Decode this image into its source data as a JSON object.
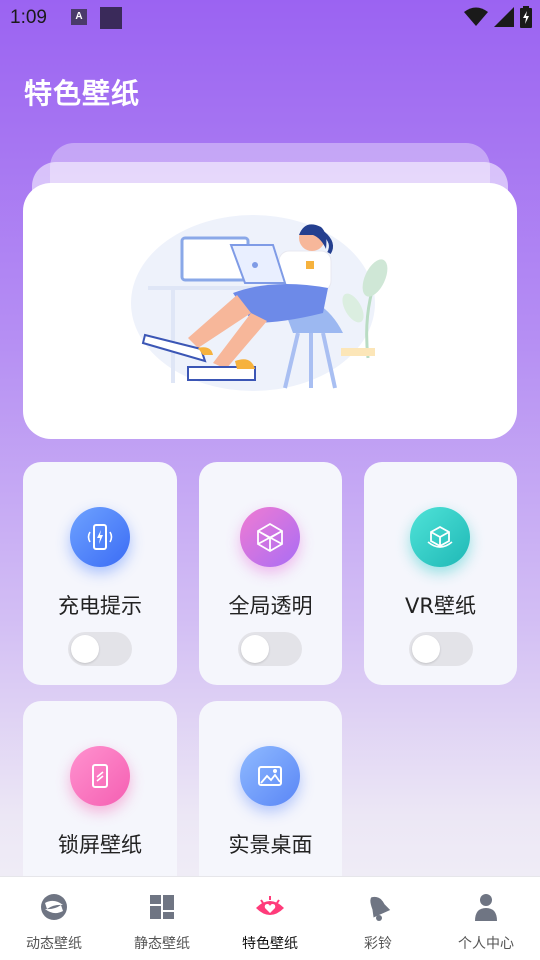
{
  "status_bar": {
    "time": "1:09",
    "a_icon_letter": "A"
  },
  "header": {
    "title": "特色壁纸"
  },
  "features": [
    {
      "label": "充电提示",
      "icon": "charging-phone-icon",
      "enabled": false
    },
    {
      "label": "全局透明",
      "icon": "cube-icon",
      "enabled": false
    },
    {
      "label": "VR壁纸",
      "icon": "vr-box-icon",
      "enabled": false
    },
    {
      "label": "锁屏壁纸",
      "icon": "lock-screen-note-icon",
      "enabled": false
    },
    {
      "label": "实景桌面",
      "icon": "image-icon",
      "enabled": false
    }
  ],
  "bottom_nav": [
    {
      "label": "动态壁纸",
      "icon": "dynamic-wallpaper-icon",
      "active": false
    },
    {
      "label": "静态壁纸",
      "icon": "static-wallpaper-icon",
      "active": false
    },
    {
      "label": "特色壁纸",
      "icon": "featured-eye-heart-icon",
      "active": true
    },
    {
      "label": "彩铃",
      "icon": "bell-icon",
      "active": false
    },
    {
      "label": "个人中心",
      "icon": "person-icon",
      "active": false
    }
  ],
  "colors": {
    "accent": "#ff3b7a",
    "header_gradient_top": "#9b63f2"
  }
}
